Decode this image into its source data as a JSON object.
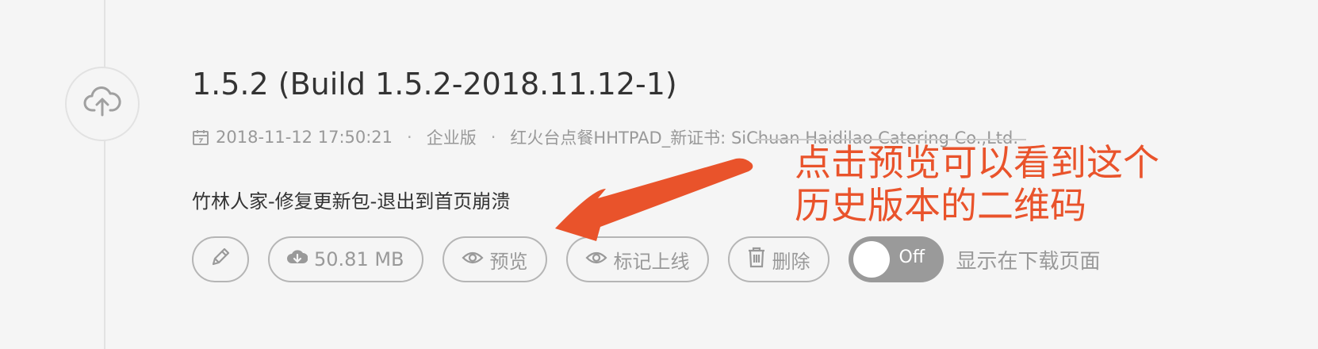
{
  "release": {
    "version_title": "1.5.2 (Build 1.5.2-2018.11.12-1)",
    "timestamp": "2018-11-12 17:50:21",
    "separator": "·",
    "edition": "企业版",
    "certificate": "红火台点餐HHTPAD_新证书: SiChuan Haidilao Catering Co.,Ltd.",
    "description": "竹林人家-修复更新包-退出到首页崩溃"
  },
  "actions": {
    "download_size": "50.81 MB",
    "preview_label": "预览",
    "mark_online_label": "标记上线",
    "delete_label": "删除",
    "toggle_state": "Off",
    "toggle_label": "显示在下载页面"
  },
  "annotation": {
    "text_line1": "点击预览可以看到这个",
    "text_line2": "历史版本的二维码",
    "color": "#e9532b"
  },
  "icons": {
    "upload": "cloud-upload-icon",
    "calendar": "calendar-icon",
    "edit": "pencil-icon",
    "download": "cloud-download-icon",
    "preview": "eye-icon",
    "mark": "eye-icon",
    "delete": "trash-icon"
  }
}
